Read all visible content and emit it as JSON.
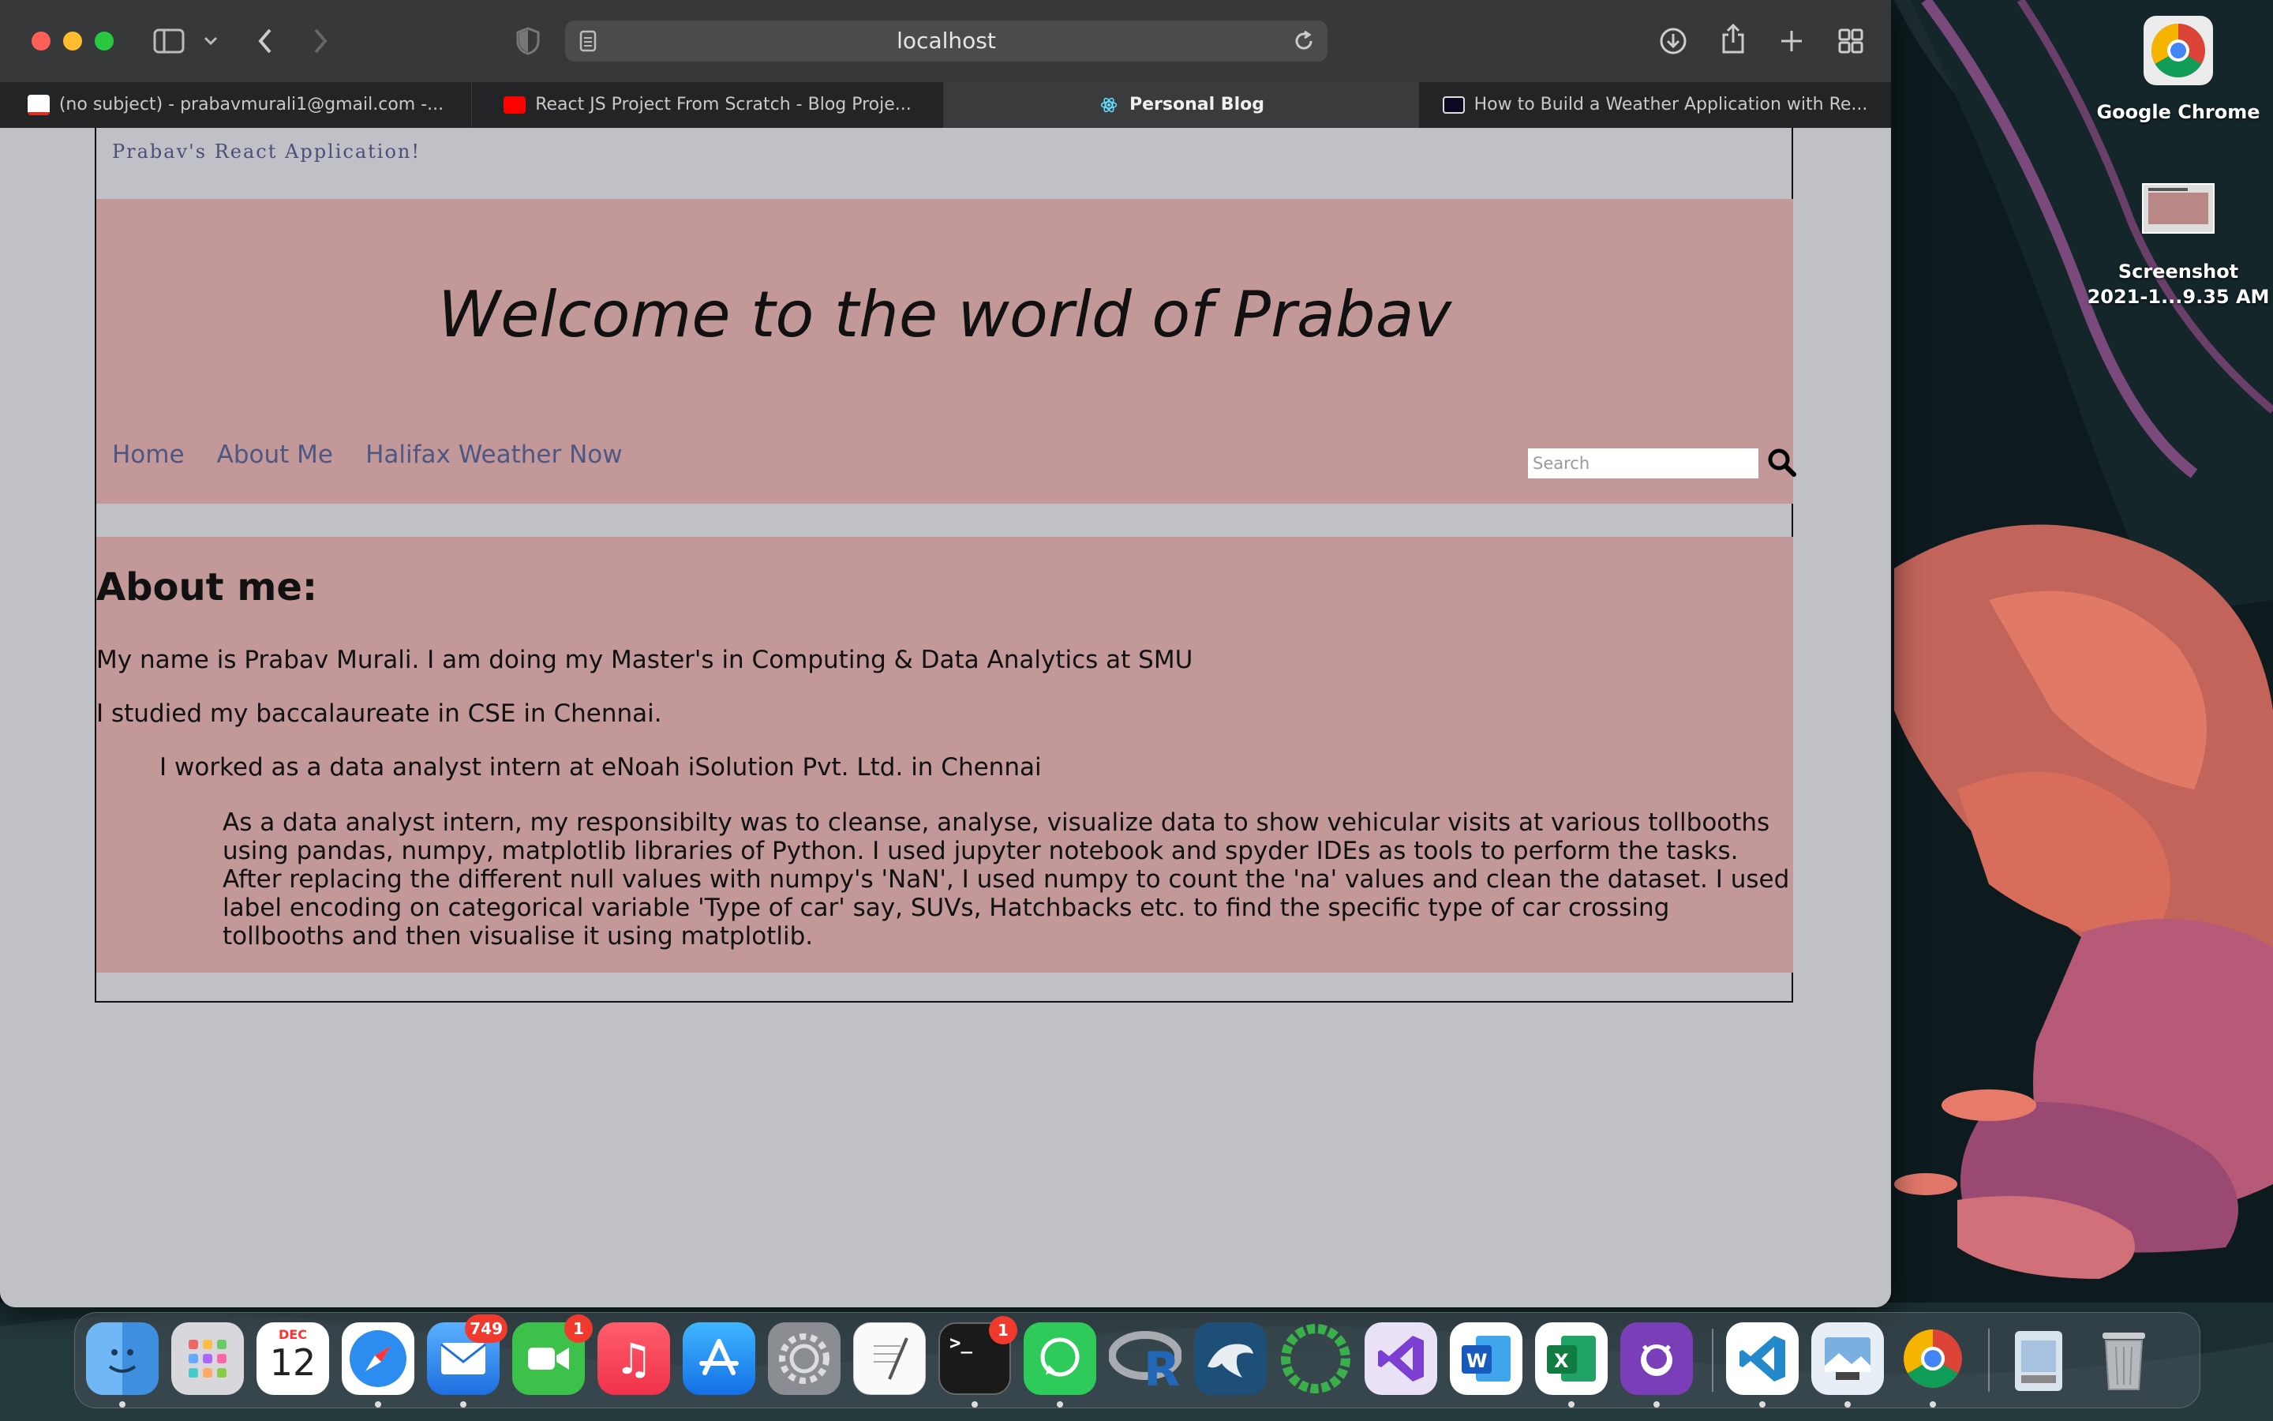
{
  "browser": {
    "url": "localhost",
    "tabs": [
      {
        "label": "(no subject) - prabavmurali1@gmail.com -...",
        "icon": "gmail-icon"
      },
      {
        "label": "React JS Project From Scratch - Blog Proje...",
        "icon": "youtube-icon"
      },
      {
        "label": "Personal Blog",
        "icon": "react-icon",
        "active": true
      },
      {
        "label": "How to Build a Weather Application with Re...",
        "icon": "freecodecamp-icon"
      }
    ]
  },
  "page": {
    "brand": "Prabav's React Application!",
    "hero_title": "Welcome to the world of Prabav",
    "nav": [
      "Home",
      "About Me",
      "Halifax Weather Now"
    ],
    "search_placeholder": "Search",
    "about_title": "About me:",
    "paragraphs": [
      "My name is Prabav Murali. I am doing my Master's in Computing & Data Analytics at SMU",
      "I studied my baccalaureate in CSE in Chennai.",
      "I worked as a data analyst intern at eNoah iSolution Pvt. Ltd. in Chennai",
      "As a data analyst intern, my responsibilty was to cleanse, analyse, visualize data to show vehicular visits at various tollbooths using pandas, numpy, matplotlib libraries of Python. I used jupyter notebook and spyder IDEs as tools to perform the tasks. After replacing the different null values with numpy's 'NaN', I used numpy to count the 'na' values and clean the dataset. I used label encoding on categorical variable 'Type of car' say, SUVs, Hatchbacks etc. to find the specific type of car crossing tollbooths and then visualise it using matplotlib."
    ],
    "colors": {
      "band": "#c29898",
      "background": "#c0c1c6",
      "nav_link": "#4e5784"
    }
  },
  "desktop": {
    "icons": [
      {
        "label": "Google Chrome",
        "icon": "chrome-icon"
      },
      {
        "label_line1": "Screenshot",
        "label_line2": "2021-1...9.35 AM",
        "icon": "screenshot-file-icon"
      }
    ]
  },
  "dock": {
    "calendar_month": "DEC",
    "calendar_day": "12",
    "mail_badge": "749",
    "facetime_badge": "1",
    "terminal_badge": "1",
    "apps": [
      "finder",
      "launchpad",
      "calendar",
      "safari",
      "mail",
      "facetime",
      "music",
      "app-store",
      "system-preferences",
      "textedit",
      "terminal",
      "whatsapp",
      "r",
      "mysql-workbench",
      "eclipse",
      "visual-studio",
      "word",
      "excel",
      "github-desktop",
      "vscode",
      "preview",
      "chrome",
      "downloads",
      "trash"
    ]
  }
}
